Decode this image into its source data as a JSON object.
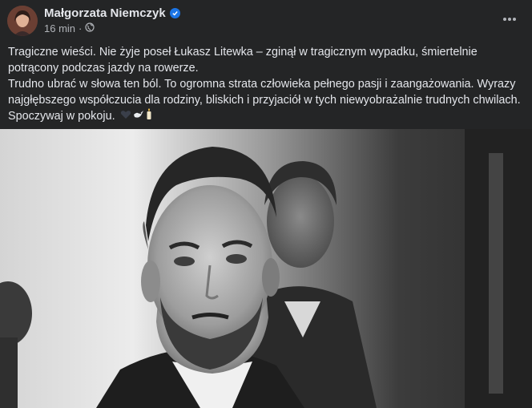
{
  "post": {
    "author_name": "Małgorzata Niemczyk",
    "timestamp": "16 min",
    "separator": "·",
    "icons": {
      "verified": "verified-badge-icon",
      "audience": "globe-icon",
      "more": "more-options-icon"
    },
    "text": {
      "line1": "Tragiczne wieści. Nie żyje poseł Łukasz Litewka – zginął w tragicznym wypadku, śmiertelnie potrącony podczas jazdy na rowerze.",
      "line2": "Trudno ubrać w słowa ten ból. To ogromna strata człowieka pełnego pasji i zaangażowania. Wyrazy najgłębszego współczucia dla rodziny, bliskich i przyjaciół w tych niewyobrażalnie trudnych chwilach.",
      "line3": "Spoczywaj w pokoju."
    },
    "emojis": [
      "black-heart-icon",
      "dove-icon",
      "candle-icon"
    ]
  },
  "colors": {
    "background": "#242526",
    "primary_text": "#e4e6eb",
    "secondary_text": "#b0b3b8",
    "verified_blue": "#1b74e4"
  }
}
